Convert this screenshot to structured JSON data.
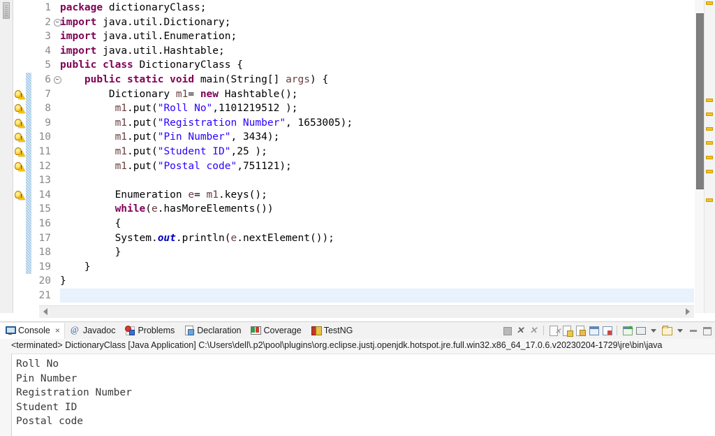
{
  "editor": {
    "language": "java",
    "first_visible_line": 1,
    "cursor_line": 21,
    "lines": [
      {
        "n": "1",
        "fold": false,
        "warn": false,
        "changed": false
      },
      {
        "n": "2",
        "fold": true,
        "warn": false,
        "changed": false
      },
      {
        "n": "3",
        "fold": false,
        "warn": false,
        "changed": false
      },
      {
        "n": "4",
        "fold": false,
        "warn": false,
        "changed": false
      },
      {
        "n": "5",
        "fold": false,
        "warn": false,
        "changed": false
      },
      {
        "n": "6",
        "fold": true,
        "warn": false,
        "changed": true
      },
      {
        "n": "7",
        "fold": false,
        "warn": true,
        "changed": true
      },
      {
        "n": "8",
        "fold": false,
        "warn": true,
        "changed": true
      },
      {
        "n": "9",
        "fold": false,
        "warn": true,
        "changed": true
      },
      {
        "n": "10",
        "fold": false,
        "warn": true,
        "changed": true
      },
      {
        "n": "11",
        "fold": false,
        "warn": true,
        "changed": true
      },
      {
        "n": "12",
        "fold": false,
        "warn": true,
        "changed": true
      },
      {
        "n": "13",
        "fold": false,
        "warn": false,
        "changed": true
      },
      {
        "n": "14",
        "fold": false,
        "warn": true,
        "changed": true
      },
      {
        "n": "15",
        "fold": false,
        "warn": false,
        "changed": true
      },
      {
        "n": "16",
        "fold": false,
        "warn": false,
        "changed": true
      },
      {
        "n": "17",
        "fold": false,
        "warn": false,
        "changed": true
      },
      {
        "n": "18",
        "fold": false,
        "warn": false,
        "changed": true
      },
      {
        "n": "19",
        "fold": false,
        "warn": false,
        "changed": true
      },
      {
        "n": "20",
        "fold": false,
        "warn": false,
        "changed": false
      },
      {
        "n": "21",
        "fold": false,
        "warn": false,
        "changed": false
      }
    ],
    "source_lines": [
      "package dictionaryClass;",
      "import java.util.Dictionary;",
      "import java.util.Enumeration;",
      "import java.util.Hashtable;",
      "public class DictionaryClass {",
      "    public static void main(String[] args) {",
      "        Dictionary m1= new Hashtable();",
      "         m1.put(\"Roll No\",1101219512 );",
      "         m1.put(\"Registration Number\", 1653005);",
      "         m1.put(\"Pin Number\", 3434);",
      "         m1.put(\"Student ID\",25 );",
      "         m1.put(\"Postal code\",751121);",
      "",
      "         Enumeration e= m1.keys();",
      "         while(e.hasMoreElements())",
      "         {",
      "         System.out.println(e.nextElement());",
      "         }",
      "    }",
      "}",
      ""
    ]
  },
  "console_view": {
    "tabs": [
      {
        "label": "Console",
        "icon": "console-icon",
        "active": true,
        "closable": true,
        "close_label": "×"
      },
      {
        "label": "Javadoc",
        "icon": "javadoc-icon",
        "active": false,
        "closable": false,
        "close_label": ""
      },
      {
        "label": "Problems",
        "icon": "problems-icon",
        "active": false,
        "closable": false,
        "close_label": ""
      },
      {
        "label": "Declaration",
        "icon": "declaration-icon",
        "active": false,
        "closable": false,
        "close_label": ""
      },
      {
        "label": "Coverage",
        "icon": "coverage-icon",
        "active": false,
        "closable": false,
        "close_label": ""
      },
      {
        "label": "TestNG",
        "icon": "testng-icon",
        "active": false,
        "closable": false,
        "close_label": ""
      }
    ],
    "toolbar_icons": [
      "terminate-icon",
      "remove-launch-icon",
      "remove-all-terminated-icon",
      "clear-console-icon",
      "scroll-lock-icon",
      "show-console-on-output-icon",
      "pin-console-icon",
      "display-selected-console-icon",
      "open-console-icon",
      "open-console-dropdown-icon",
      "new-console-view-icon",
      "view-menu-icon",
      "minimize-icon",
      "maximize-icon"
    ],
    "launch_status": "<terminated> DictionaryClass [Java Application] C:\\Users\\dell\\.p2\\pool\\plugins\\org.eclipse.justj.openjdk.hotspot.jre.full.win32.x86_64_17.0.6.v20230204-1729\\jre\\bin\\java",
    "output_lines": [
      "Roll No",
      "Pin Number",
      "Registration Number",
      "Student ID",
      "Postal code"
    ]
  },
  "colors": {
    "keyword": "#7f0055",
    "string": "#2a00ff",
    "local_variable": "#6a3e3e",
    "static_field": "#0000c0",
    "line_number": "#888888",
    "warning_marker": "#f5c518",
    "changed_bar": "#a8cbe8",
    "current_line": "#e8f2fd",
    "editor_background": "#ffffff",
    "console_background": "#ffffff",
    "chrome_background": "#f2f2f2"
  },
  "overview_ruler": {
    "marker_count": 7,
    "marker_type": "warning"
  }
}
